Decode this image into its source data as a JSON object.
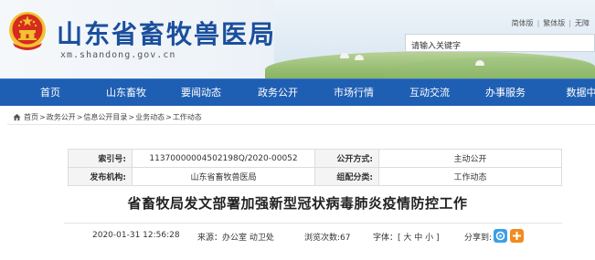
{
  "header": {
    "site_title": "山东省畜牧兽医局",
    "domain": "xm.shandong.gov.cn",
    "lang_links": [
      "简体版",
      "繁体版",
      "无障"
    ],
    "search_placeholder": "请输入关键字"
  },
  "nav": {
    "items": [
      "首页",
      "山东畜牧",
      "要闻动态",
      "政务公开",
      "市场行情",
      "互动交流",
      "办事服务",
      "数据中"
    ]
  },
  "breadcrumb": [
    "首页",
    "政务公开",
    "信息公开目录",
    "业务动态",
    "工作动态"
  ],
  "meta": {
    "index_label": "索引号:",
    "index_value": "11370000004502198Q/2020-00052",
    "public_label": "公开方式:",
    "public_value": "主动公开",
    "publisher_label": "发布机构:",
    "publisher_value": "山东省畜牧兽医局",
    "category_label": "组配分类:",
    "category_value": "工作动态"
  },
  "article": {
    "title": "省畜牧局发文部署加强新型冠状病毒肺炎疫情防控工作",
    "datetime": "2020-01-31 12:56:28",
    "source": "来源：办公室 动卫处",
    "views": "浏览次数:67",
    "font_size_label": "字体：[ 大 中 小 ]",
    "share_label": "分享到:"
  },
  "colors": {
    "brand_blue": "#1a4f9c",
    "nav_bg": "#1f5fb3",
    "emblem_red": "#d62b1f",
    "emblem_gold": "#f2c230"
  }
}
